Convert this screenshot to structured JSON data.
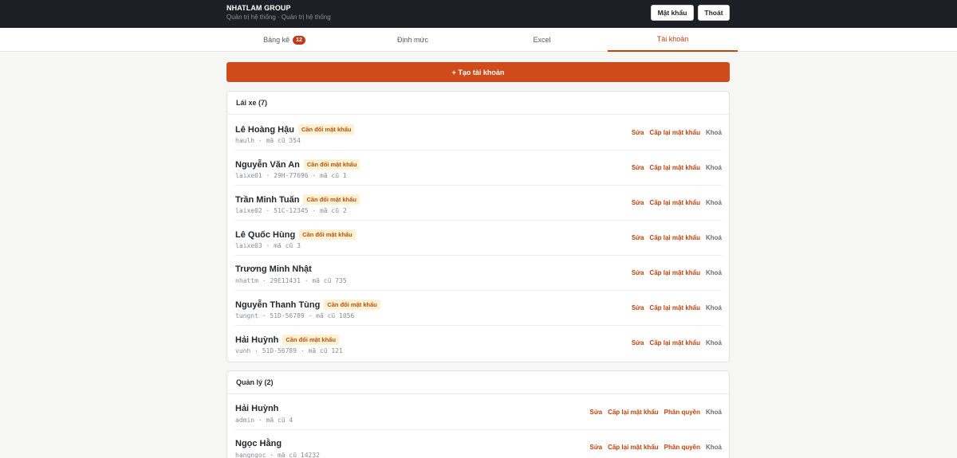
{
  "header": {
    "brand": "NHATLAM GROUP",
    "subtitle": "Quản trị hệ thống · Quản trị hệ thống",
    "password_button": "Mật khẩu",
    "logout_button": "Thoát"
  },
  "tabs": [
    {
      "label": "Bảng kê",
      "badge": "12"
    },
    {
      "label": "Định mức"
    },
    {
      "label": "Excel"
    },
    {
      "label": "Tài khoản",
      "active": true
    }
  ],
  "create_button": "+ Tạo tài khoản",
  "actions": {
    "edit": "Sửa",
    "reset_password": "Cấp lại mật khẩu",
    "permissions": "Phân quyền",
    "lock": "Khoá"
  },
  "drivers": {
    "title": "Lái xe (7)",
    "items": [
      {
        "name": "Lê Hoàng Hậu",
        "tag": "Cần đổi mật khẩu",
        "meta": "haulh · mã cũ 354"
      },
      {
        "name": "Nguyễn Văn An",
        "tag": "Cần đổi mật khẩu",
        "meta": "laixe01 · 29H-77696 · mã cũ 1"
      },
      {
        "name": "Trần Minh Tuấn",
        "tag": "Cần đổi mật khẩu",
        "meta": "laixe02 · 51C-12345 · mã cũ 2"
      },
      {
        "name": "Lê Quốc Hùng",
        "tag": "Cần đổi mật khẩu",
        "meta": "laixe03 · mã cũ 3"
      },
      {
        "name": "Trương Minh Nhật",
        "tag": "",
        "meta": "nhattm · 29E11431 · mã cũ 735"
      },
      {
        "name": "Nguyễn Thanh Tùng",
        "tag": "Cần đổi mật khẩu",
        "meta": "tungnt · 51D-56789 · mã cũ 1056"
      },
      {
        "name": "Hải Huỳnh",
        "tag": "Cần đổi mật khẩu",
        "meta": "vunh · 51D-56789 · mã cũ 121"
      }
    ]
  },
  "managers": {
    "title": "Quản lý (2)",
    "items": [
      {
        "name": "Hải Huỳnh",
        "meta": "admin · mã cũ 4"
      },
      {
        "name": "Ngọc Hằng",
        "meta": "hangngoc · mã cũ 14232"
      }
    ]
  }
}
